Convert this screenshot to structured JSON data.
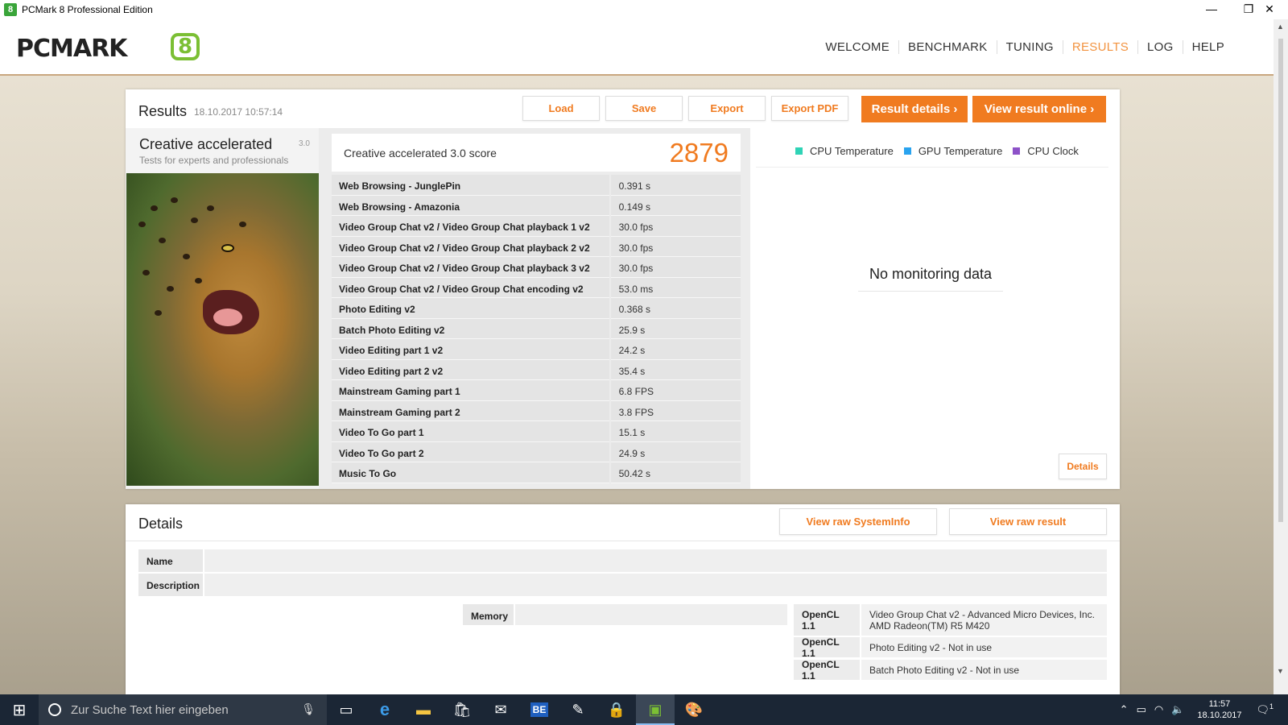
{
  "window": {
    "title": "PCMark 8 Professional Edition",
    "app_icon_text": "8",
    "minimize": "—",
    "restore": "❐",
    "close": "✕"
  },
  "header": {
    "logo_text": "PCMARK",
    "logo_mark": "8"
  },
  "nav": {
    "items": [
      {
        "label": "WELCOME",
        "active": false
      },
      {
        "label": "BENCHMARK",
        "active": false
      },
      {
        "label": "TUNING",
        "active": false
      },
      {
        "label": "RESULTS",
        "active": true
      },
      {
        "label": "LOG",
        "active": false
      },
      {
        "label": "HELP",
        "active": false
      }
    ]
  },
  "results": {
    "title": "Results",
    "date": "18.10.2017 10:57:14",
    "buttons": {
      "load": "Load",
      "save": "Save",
      "export": "Export",
      "export_pdf": "Export PDF",
      "result_details": "Result details",
      "view_online": "View result online"
    },
    "test_name": "Creative accelerated",
    "test_version": "3.0",
    "test_subtitle": "Tests for experts and professionals",
    "score_label": "Creative accelerated 3.0 score",
    "score_value": "2879",
    "benchmarks": [
      {
        "name": "Web Browsing - JunglePin",
        "value": "0.391 s"
      },
      {
        "name": "Web Browsing - Amazonia",
        "value": "0.149 s"
      },
      {
        "name": "Video Group Chat v2 / Video Group Chat playback 1 v2",
        "value": "30.0 fps"
      },
      {
        "name": "Video Group Chat v2 / Video Group Chat playback 2 v2",
        "value": "30.0 fps"
      },
      {
        "name": "Video Group Chat v2 / Video Group Chat playback 3 v2",
        "value": "30.0 fps"
      },
      {
        "name": "Video Group Chat v2 / Video Group Chat encoding v2",
        "value": "53.0 ms"
      },
      {
        "name": "Photo Editing v2",
        "value": "0.368 s"
      },
      {
        "name": "Batch Photo Editing v2",
        "value": "25.9 s"
      },
      {
        "name": "Video Editing part 1 v2",
        "value": "24.2 s"
      },
      {
        "name": "Video Editing part 2 v2",
        "value": "35.4 s"
      },
      {
        "name": "Mainstream Gaming part 1",
        "value": "6.8 FPS"
      },
      {
        "name": "Mainstream Gaming part 2",
        "value": "3.8 FPS"
      },
      {
        "name": "Video To Go part 1",
        "value": "15.1 s"
      },
      {
        "name": "Video To Go part 2",
        "value": "24.9 s"
      },
      {
        "name": "Music To Go",
        "value": "50.42 s"
      }
    ],
    "legend": [
      {
        "label": "CPU Temperature",
        "color": "#2fd3b6"
      },
      {
        "label": "GPU Temperature",
        "color": "#29a3ef"
      },
      {
        "label": "CPU Clock",
        "color": "#8d52c8"
      }
    ],
    "no_data": "No monitoring data",
    "details_button": "Details"
  },
  "details": {
    "title": "Details",
    "view_sysinfo": "View raw SystemInfo",
    "view_raw": "View raw result",
    "name_label": "Name",
    "description_label": "Description",
    "memory_label": "Memory",
    "opencl": [
      {
        "key": "OpenCL 1.1",
        "value": "Video Group Chat v2 - Advanced Micro Devices, Inc. AMD Radeon(TM) R5 M420"
      },
      {
        "key": "OpenCL 1.1",
        "value": "Photo Editing v2 - Not in use"
      },
      {
        "key": "OpenCL 1.1",
        "value": "Batch Photo Editing v2 - Not in use"
      }
    ]
  },
  "taskbar": {
    "search_placeholder": "Zur Suche Text hier eingeben",
    "time": "11:57",
    "date": "18.10.2017",
    "notification_count": "1"
  }
}
